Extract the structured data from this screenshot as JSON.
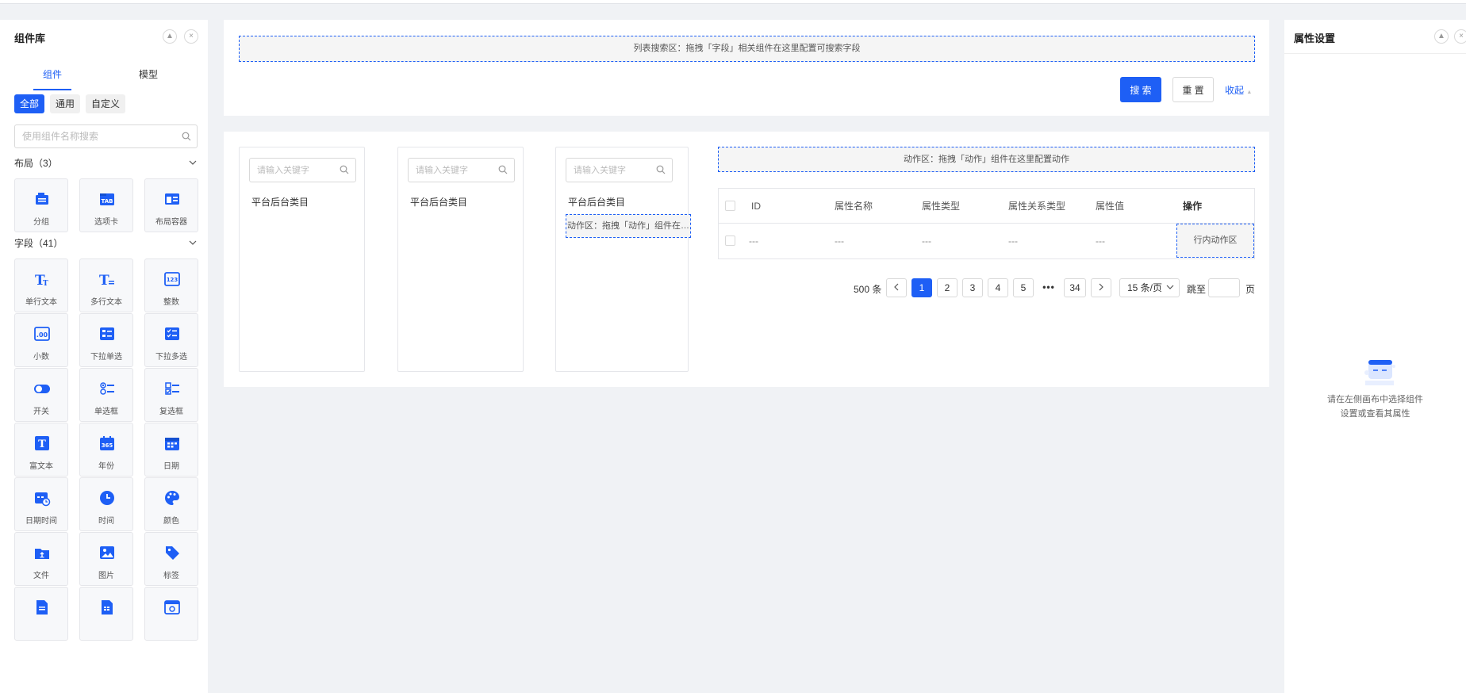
{
  "left_panel": {
    "title": "组件库",
    "tabs": [
      "组件",
      "模型"
    ],
    "filters": [
      "全部",
      "通用",
      "自定义"
    ],
    "search_placeholder": "使用组件名称搜索",
    "sections": [
      {
        "title": "布局（3）",
        "items": [
          {
            "label": "分组",
            "icon": "group-icon"
          },
          {
            "label": "选项卡",
            "icon": "tab-icon"
          },
          {
            "label": "布局容器",
            "icon": "layout-container-icon"
          }
        ]
      },
      {
        "title": "字段（41）",
        "items": [
          {
            "label": "单行文本",
            "icon": "single-line-text-icon"
          },
          {
            "label": "多行文本",
            "icon": "multi-line-text-icon"
          },
          {
            "label": "整数",
            "icon": "integer-icon"
          },
          {
            "label": "小数",
            "icon": "decimal-icon"
          },
          {
            "label": "下拉单选",
            "icon": "dropdown-single-icon"
          },
          {
            "label": "下拉多选",
            "icon": "dropdown-multi-icon"
          },
          {
            "label": "开关",
            "icon": "switch-icon"
          },
          {
            "label": "单选框",
            "icon": "radio-icon"
          },
          {
            "label": "复选框",
            "icon": "checkbox-icon"
          },
          {
            "label": "富文本",
            "icon": "rich-text-icon"
          },
          {
            "label": "年份",
            "icon": "year-icon"
          },
          {
            "label": "日期",
            "icon": "date-icon"
          },
          {
            "label": "日期时间",
            "icon": "datetime-icon"
          },
          {
            "label": "时间",
            "icon": "time-icon"
          },
          {
            "label": "颜色",
            "icon": "color-icon"
          },
          {
            "label": "文件",
            "icon": "file-icon"
          },
          {
            "label": "图片",
            "icon": "image-icon"
          },
          {
            "label": "标签",
            "icon": "tag-icon"
          }
        ]
      }
    ]
  },
  "search_area": {
    "drop_hint": "列表搜索区：拖拽「字段」相关组件在这里配置可搜索字段",
    "search_button": "搜 索",
    "reset_button": "重 置",
    "collapse_link": "收起"
  },
  "tree_columns": [
    {
      "placeholder": "请输入关键字",
      "label": "平台后台类目"
    },
    {
      "placeholder": "请输入关键字",
      "label": "平台后台类目"
    },
    {
      "placeholder": "请输入关键字",
      "label": "平台后台类目",
      "action_hint": "动作区：拖拽「动作」组件在这里配置动作"
    }
  ],
  "action_zone": "动作区：拖拽「动作」组件在这里配置动作",
  "table": {
    "headers": [
      "ID",
      "属性名称",
      "属性类型",
      "属性关系类型",
      "属性值",
      "操作"
    ],
    "row": [
      "---",
      "---",
      "---",
      "---",
      "---"
    ],
    "row_action": "行内动作区"
  },
  "pagination": {
    "total": "500 条",
    "pages": [
      "1",
      "2",
      "3",
      "4",
      "5",
      "•••",
      "34"
    ],
    "current": "1",
    "page_size": "15 条/页",
    "jump_label": "跳至",
    "page_suffix": "页"
  },
  "right_panel": {
    "title": "属性设置",
    "empty_line1": "请在左侧画布中选择组件",
    "empty_line2": "设置或查看其属性"
  },
  "colors": {
    "accent": "#1e5ff5",
    "background": "#f0f2f5"
  }
}
